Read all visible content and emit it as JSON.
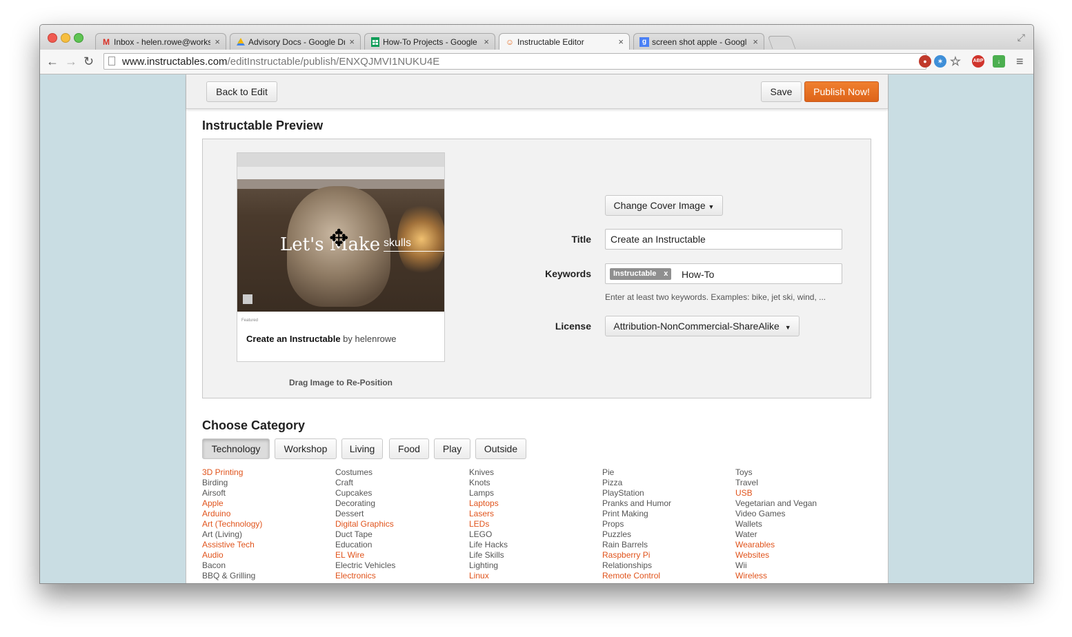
{
  "browser": {
    "tabs": [
      {
        "title": "Inbox - helen.rowe@works",
        "favicon": "gmail-icon"
      },
      {
        "title": "Advisory Docs - Google Dr",
        "favicon": "google-drive-icon"
      },
      {
        "title": "How-To Projects - Google",
        "favicon": "google-sheets-icon"
      },
      {
        "title": "Instructable Editor",
        "favicon": "instructables-icon"
      },
      {
        "title": "screen shot apple - Googl",
        "favicon": "google-icon"
      }
    ],
    "url_host": "www.instructables.com",
    "url_path": "/editInstructable/publish/ENXQJMVI1NUKU4E"
  },
  "topbar": {
    "back_label": "Back to Edit",
    "save_label": "Save",
    "publish_label": "Publish Now!"
  },
  "preview": {
    "heading": "Instructable Preview",
    "overlay_text": "Let's Make",
    "overlay_text2": "skulls",
    "featured": "Featured",
    "card_title": "Create an Instructable",
    "card_by": "by",
    "card_author": "helenrowe",
    "drag_hint": "Drag Image to Re-Position"
  },
  "form": {
    "cover_label": "Change Cover Image",
    "title_label": "Title",
    "title_value": "Create an Instructable",
    "keywords_label": "Keywords",
    "keyword_tag": "Instructable",
    "keyword_input": "How-To",
    "keywords_hint": "Enter at least two keywords. Examples: bike, jet ski, wind, ...",
    "license_label": "License",
    "license_value": "Attribution-NonCommercial-ShareAlike"
  },
  "category": {
    "heading": "Choose Category",
    "tabs": [
      "Technology",
      "Workshop",
      "Living",
      "Food",
      "Play",
      "Outside"
    ],
    "active_tab": "Technology",
    "columns": [
      [
        {
          "name": "3D Printing",
          "link": true
        },
        {
          "name": "Birding",
          "link": false
        },
        {
          "name": "Airsoft",
          "link": false
        },
        {
          "name": "Apple",
          "link": true
        },
        {
          "name": "Arduino",
          "link": true
        },
        {
          "name": "Art (Technology)",
          "link": true
        },
        {
          "name": "Art (Living)",
          "link": false
        },
        {
          "name": "Assistive Tech",
          "link": true
        },
        {
          "name": "Audio",
          "link": true
        },
        {
          "name": "Bacon",
          "link": false
        },
        {
          "name": "BBQ & Grilling",
          "link": false
        }
      ],
      [
        {
          "name": "Costumes",
          "link": false
        },
        {
          "name": "Craft",
          "link": false
        },
        {
          "name": "Cupcakes",
          "link": false
        },
        {
          "name": "Decorating",
          "link": false
        },
        {
          "name": "Dessert",
          "link": false
        },
        {
          "name": "Digital Graphics",
          "link": true
        },
        {
          "name": "Duct Tape",
          "link": false
        },
        {
          "name": "Education",
          "link": false
        },
        {
          "name": "EL Wire",
          "link": true
        },
        {
          "name": "Electric Vehicles",
          "link": false
        },
        {
          "name": "Electronics",
          "link": true
        }
      ],
      [
        {
          "name": "Knives",
          "link": false
        },
        {
          "name": "Knots",
          "link": false
        },
        {
          "name": "Lamps",
          "link": false
        },
        {
          "name": "Laptops",
          "link": true
        },
        {
          "name": "Lasers",
          "link": true
        },
        {
          "name": "LEDs",
          "link": true
        },
        {
          "name": "LEGO",
          "link": false
        },
        {
          "name": "Life Hacks",
          "link": false
        },
        {
          "name": "Life Skills",
          "link": false
        },
        {
          "name": "Lighting",
          "link": false
        },
        {
          "name": "Linux",
          "link": true
        }
      ],
      [
        {
          "name": "Pie",
          "link": false
        },
        {
          "name": "Pizza",
          "link": false
        },
        {
          "name": "PlayStation",
          "link": false
        },
        {
          "name": "Pranks and Humor",
          "link": false
        },
        {
          "name": "Print Making",
          "link": false
        },
        {
          "name": "Props",
          "link": false
        },
        {
          "name": "Puzzles",
          "link": false
        },
        {
          "name": "Rain Barrels",
          "link": false
        },
        {
          "name": "Raspberry Pi",
          "link": true
        },
        {
          "name": "Relationships",
          "link": false
        },
        {
          "name": "Remote Control",
          "link": true
        }
      ],
      [
        {
          "name": "Toys",
          "link": false
        },
        {
          "name": "Travel",
          "link": false
        },
        {
          "name": "USB",
          "link": true
        },
        {
          "name": "Vegetarian and Vegan",
          "link": false
        },
        {
          "name": "Video Games",
          "link": false
        },
        {
          "name": "Wallets",
          "link": false
        },
        {
          "name": "Water",
          "link": false
        },
        {
          "name": "Wearables",
          "link": true
        },
        {
          "name": "Websites",
          "link": true
        },
        {
          "name": "Wii",
          "link": false
        },
        {
          "name": "Wireless",
          "link": true
        }
      ]
    ]
  },
  "colors": {
    "accent": "#e0531b",
    "publish": "#e8712a",
    "page_bg": "#c9dde3"
  }
}
